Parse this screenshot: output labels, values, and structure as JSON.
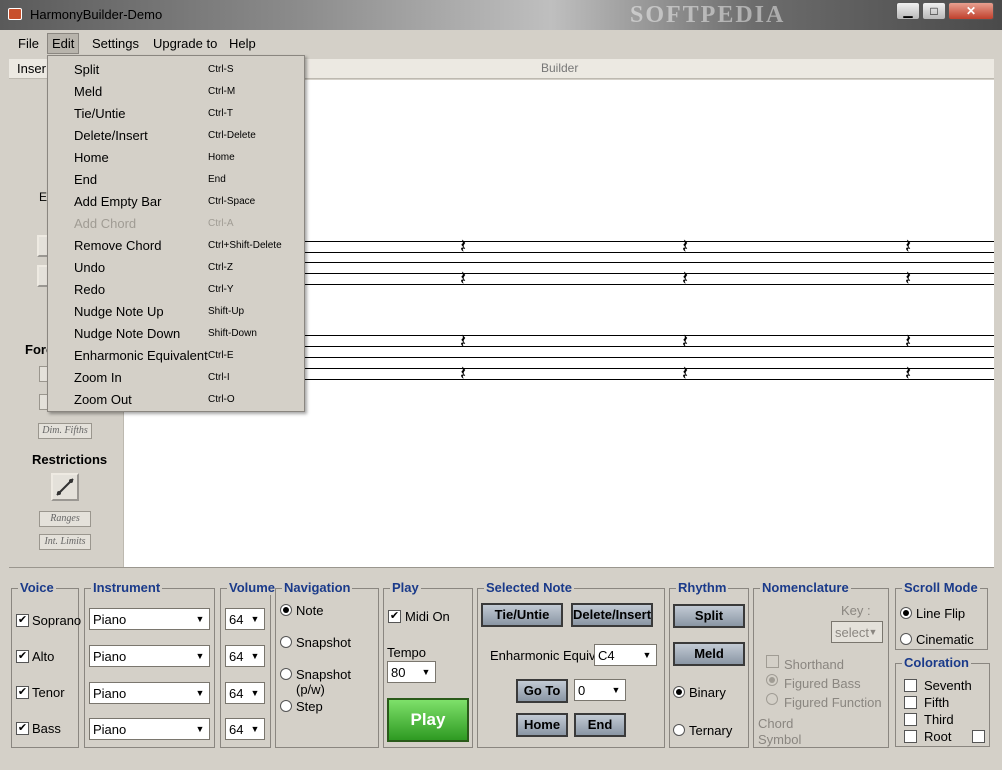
{
  "window": {
    "title": "HarmonyBuilder-Demo",
    "watermark": "SOFTPEDIA",
    "min_glyph": "▁",
    "max_glyph": "□",
    "close_glyph": "✕"
  },
  "menubar": {
    "items": [
      "File",
      "Edit",
      "Settings",
      "Upgrade to",
      "Help"
    ]
  },
  "toolstrip": {
    "insert_tab": "Inser",
    "builder_label": "Builder"
  },
  "left_panel": {
    "ex_label": "Ex",
    "forbidden_label": "Forc",
    "dim_fifths": "Dim. Fifths",
    "restrictions_heading": "Restrictions",
    "ranges": "Ranges",
    "int_limits": "Int. Limits"
  },
  "edit_menu": [
    {
      "label": "Split",
      "shortcut": "Ctrl-S",
      "enabled": true
    },
    {
      "label": "Meld",
      "shortcut": "Ctrl-M",
      "enabled": true
    },
    {
      "label": "Tie/Untie",
      "shortcut": "Ctrl-T",
      "enabled": true
    },
    {
      "label": "Delete/Insert",
      "shortcut": "Ctrl-Delete",
      "enabled": true
    },
    {
      "label": "Home",
      "shortcut": "Home",
      "enabled": true
    },
    {
      "label": "End",
      "shortcut": "End",
      "enabled": true
    },
    {
      "label": "Add Empty Bar",
      "shortcut": "Ctrl-Space",
      "enabled": true
    },
    {
      "label": "Add Chord",
      "shortcut": "Ctrl-A",
      "enabled": false
    },
    {
      "label": "Remove Chord",
      "shortcut": "Ctrl+Shift-Delete",
      "enabled": true
    },
    {
      "label": "Undo",
      "shortcut": "Ctrl-Z",
      "enabled": true
    },
    {
      "label": "Redo",
      "shortcut": "Ctrl-Y",
      "enabled": true
    },
    {
      "label": "Nudge Note Up",
      "shortcut": "Shift-Up",
      "enabled": true
    },
    {
      "label": "Nudge Note Down",
      "shortcut": "Shift-Down",
      "enabled": true
    },
    {
      "label": "Enharmonic Equivalent",
      "shortcut": "Ctrl-E",
      "enabled": true
    },
    {
      "label": "Zoom In",
      "shortcut": "Ctrl-I",
      "enabled": true
    },
    {
      "label": "Zoom Out",
      "shortcut": "Ctrl-O",
      "enabled": true
    }
  ],
  "voice": {
    "title": "Voice",
    "items": [
      {
        "label": "Soprano",
        "checked": true,
        "check_glyph": "✔"
      },
      {
        "label": "Alto",
        "checked": true,
        "check_glyph": "✔"
      },
      {
        "label": "Tenor",
        "checked": true,
        "check_glyph": "✔"
      },
      {
        "label": "Bass",
        "checked": true,
        "check_glyph": "✔"
      }
    ]
  },
  "instrument": {
    "title": "Instrument",
    "values": [
      "Piano",
      "Piano",
      "Piano",
      "Piano"
    ]
  },
  "volume": {
    "title": "Volume",
    "values": [
      "64",
      "64",
      "64",
      "64"
    ]
  },
  "navigation": {
    "title": "Navigation",
    "options": [
      "Note",
      "Snapshot",
      "Snapshot (p/w)",
      "Step"
    ],
    "selected": "Note"
  },
  "play": {
    "title": "Play",
    "midi_on_label": "Midi On",
    "midi_on": true,
    "midi_glyph": "✔",
    "tempo_label": "Tempo",
    "tempo_value": "80",
    "play_label": "Play"
  },
  "selected_note": {
    "title": "Selected Note",
    "tie_untie": "Tie/Untie",
    "delete_insert": "Delete/Insert",
    "enharmonic_label": "Enharmonic Equiv.",
    "enharmonic_value": "C4",
    "go_to": "Go To",
    "go_to_value": "0",
    "home": "Home",
    "end": "End"
  },
  "rhythm": {
    "title": "Rhythm",
    "split": "Split",
    "meld": "Meld",
    "options": [
      "Binary",
      "Ternary"
    ],
    "selected": "Binary"
  },
  "nomenclature": {
    "title": "Nomenclature",
    "key_label": "Key :",
    "key_value": "select",
    "shorthand": "Shorthand",
    "figured_bass": "Figured Bass",
    "figured_function": "Figured Function",
    "chord_symbol_line1": "Chord",
    "chord_symbol_line2": "Symbol"
  },
  "scroll_mode": {
    "title": "Scroll Mode",
    "options": [
      "Line Flip",
      "Cinematic"
    ],
    "selected": "Line Flip"
  },
  "coloration": {
    "title": "Coloration",
    "items": [
      "Seventh",
      "Fifth",
      "Third",
      "Root"
    ]
  },
  "icons": {
    "dropdown_arrow": "▼",
    "rest": "𝄽"
  }
}
